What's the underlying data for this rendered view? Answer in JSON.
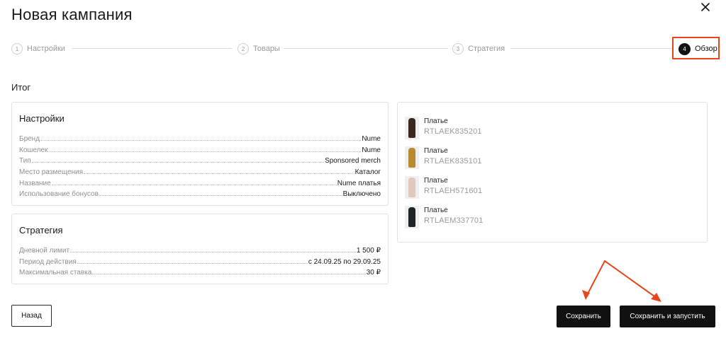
{
  "modal": {
    "title": "Новая кампания"
  },
  "stepper": {
    "steps": [
      {
        "num": "1",
        "label": "Настройки"
      },
      {
        "num": "2",
        "label": "Товары"
      },
      {
        "num": "3",
        "label": "Стратегия"
      },
      {
        "num": "4",
        "label": "Обзор"
      }
    ],
    "active_index": 3
  },
  "summary_label": "Итог",
  "settings": {
    "title": "Настройки",
    "rows": [
      {
        "key": "Бренд",
        "value": "Nume"
      },
      {
        "key": "Кошелек",
        "value": "Nume"
      },
      {
        "key": "Тип",
        "value": "Sponsored merch"
      },
      {
        "key": "Место размещения",
        "value": "Каталог"
      },
      {
        "key": "Название",
        "value": "Nume платья"
      },
      {
        "key": "Использование бонусов",
        "value": "Выключено"
      }
    ]
  },
  "strategy": {
    "title": "Стратегия",
    "rows": [
      {
        "key": "Дневной лимит",
        "value": "1 500 ₽"
      },
      {
        "key": "Период действия",
        "value": "с 24.09.25 по 29.09.25"
      },
      {
        "key": "Максимальная ставка",
        "value": "30 ₽"
      }
    ]
  },
  "products": [
    {
      "name": "Платье",
      "sku": "RTLAEK835201",
      "color": "#3b2620"
    },
    {
      "name": "Платье",
      "sku": "RTLAEK835101",
      "color": "#b98a2e"
    },
    {
      "name": "Платье",
      "sku": "RTLAEH571601",
      "color": "#e2c7bd"
    },
    {
      "name": "Платье",
      "sku": "RTLAEM337701",
      "color": "#1f2226"
    }
  ],
  "buttons": {
    "back": "Назад",
    "save": "Сохранить",
    "save_and_launch": "Сохранить и запустить"
  },
  "colors": {
    "accent": "#e8451e",
    "primary_button": "#111111"
  }
}
